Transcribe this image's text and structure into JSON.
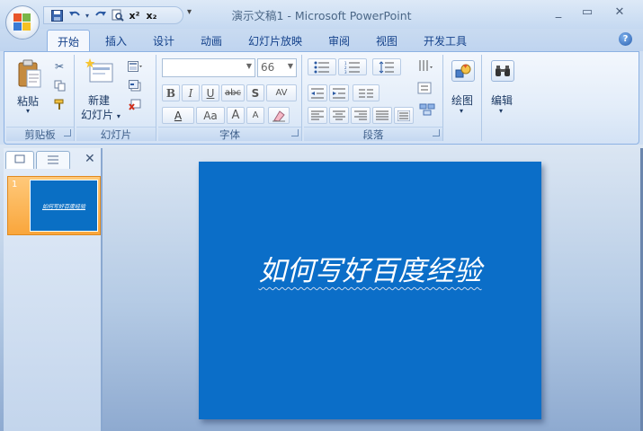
{
  "window": {
    "title": "演示文稿1 - Microsoft PowerPoint",
    "controls": {
      "minimize": "_",
      "restore": "▭",
      "close": "✕"
    }
  },
  "quick_access": {
    "icons": [
      "save-icon",
      "undo-icon",
      "redo-icon",
      "print-preview-icon",
      "superscript-icon",
      "subscript-icon"
    ],
    "superscript_label": "x²",
    "subscript_label": "x₂",
    "more": "▾"
  },
  "tabs": [
    "开始",
    "插入",
    "设计",
    "动画",
    "幻灯片放映",
    "审阅",
    "视图",
    "开发工具"
  ],
  "ribbon": {
    "clipboard": {
      "paste_label": "粘贴",
      "caption": "剪贴板"
    },
    "slides": {
      "new_slide_label_1": "新建",
      "new_slide_label_2": "幻灯片",
      "caption": "幻灯片"
    },
    "font": {
      "font_name_value": "",
      "font_size_value": "66",
      "bold": "B",
      "italic": "I",
      "underline": "U",
      "strike": "abc",
      "shadow": "S",
      "spacing": "AV",
      "font_color": "A",
      "change_case": "Aa",
      "grow": "A",
      "shrink": "A",
      "caption": "字体"
    },
    "paragraph": {
      "caption": "段落"
    },
    "drawing": {
      "label": "绘图"
    },
    "editing": {
      "label": "编辑"
    }
  },
  "slides_pane": {
    "tab_slides_icon": "slides-tab-icon",
    "tab_outline_icon": "outline-tab-icon",
    "close": "✕",
    "thumbnails": [
      {
        "number": "1",
        "title": "如何写好百度经验"
      }
    ]
  },
  "slide": {
    "title": "如何写好百度经验",
    "background": "#0b6ec8"
  }
}
